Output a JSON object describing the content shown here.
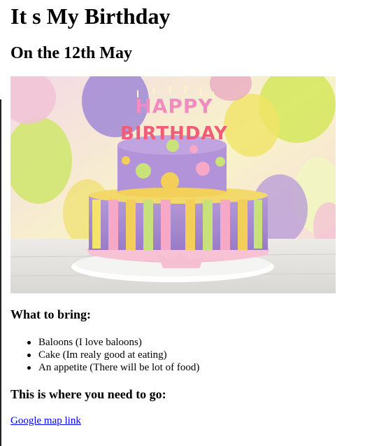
{
  "page": {
    "title": "It s My Birthday",
    "subtitle": "On the 12th May"
  },
  "hero_image": {
    "cake_text_top": "HAPPY",
    "cake_text_bottom": "BIRTHDAY"
  },
  "bring_section": {
    "heading": "What to bring:",
    "items": [
      "Baloons (I love baloons)",
      "Cake (Im realy good at eating)",
      "An appetite (There will be lot of food)"
    ]
  },
  "location_section": {
    "heading": "This is where you need to go:",
    "link_label": "Google map link"
  },
  "colors": {
    "link": "#0000ee",
    "text": "#000000"
  }
}
